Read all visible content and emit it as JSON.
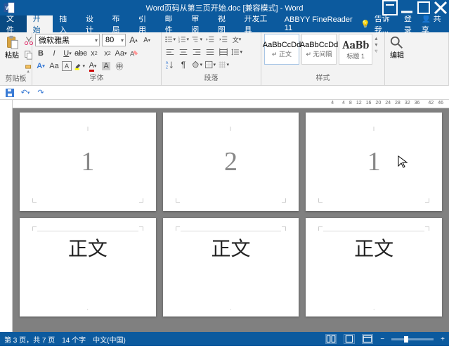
{
  "title": "Word页码从第三页开始.doc [兼容模式] - Word",
  "tabs": {
    "file": "文件",
    "home": "开始",
    "insert": "插入",
    "design": "设计",
    "layout": "布局",
    "ref": "引用",
    "mail": "邮件",
    "review": "审阅",
    "view": "视图",
    "dev": "开发工具",
    "abbyy": "ABBYY FineReader 11",
    "tell": "告诉我...",
    "login": "登录",
    "share": "共享"
  },
  "ribbon": {
    "clipboard": {
      "label": "剪贴板",
      "paste": "粘贴"
    },
    "font": {
      "label": "字体",
      "family": "微软雅黑",
      "size": "80"
    },
    "para": {
      "label": "段落"
    },
    "styles": {
      "label": "样式",
      "s1": {
        "preview": "AaBbCcDd",
        "name": "正文"
      },
      "s2": {
        "preview": "AaBbCcDd",
        "name": "无间隔"
      },
      "s3": {
        "preview": "AaBb",
        "name": "标题 1"
      }
    },
    "edit": {
      "label": "编辑"
    }
  },
  "ruler": {
    "h": [
      "4",
      "",
      "4",
      "8",
      "12",
      "16",
      "20",
      "24",
      "28",
      "32",
      "36",
      "",
      "42",
      "46"
    ]
  },
  "pages": {
    "p1": {
      "num": "1"
    },
    "p2": {
      "num": "2"
    },
    "p3": {
      "num": "1"
    },
    "p4": {
      "text": "正文"
    },
    "p5": {
      "text": "正文"
    },
    "p6": {
      "text": "正文"
    }
  },
  "status": {
    "page": "第 3 页，共 7 页",
    "words": "14 个字",
    "lang": "中文(中国)"
  }
}
